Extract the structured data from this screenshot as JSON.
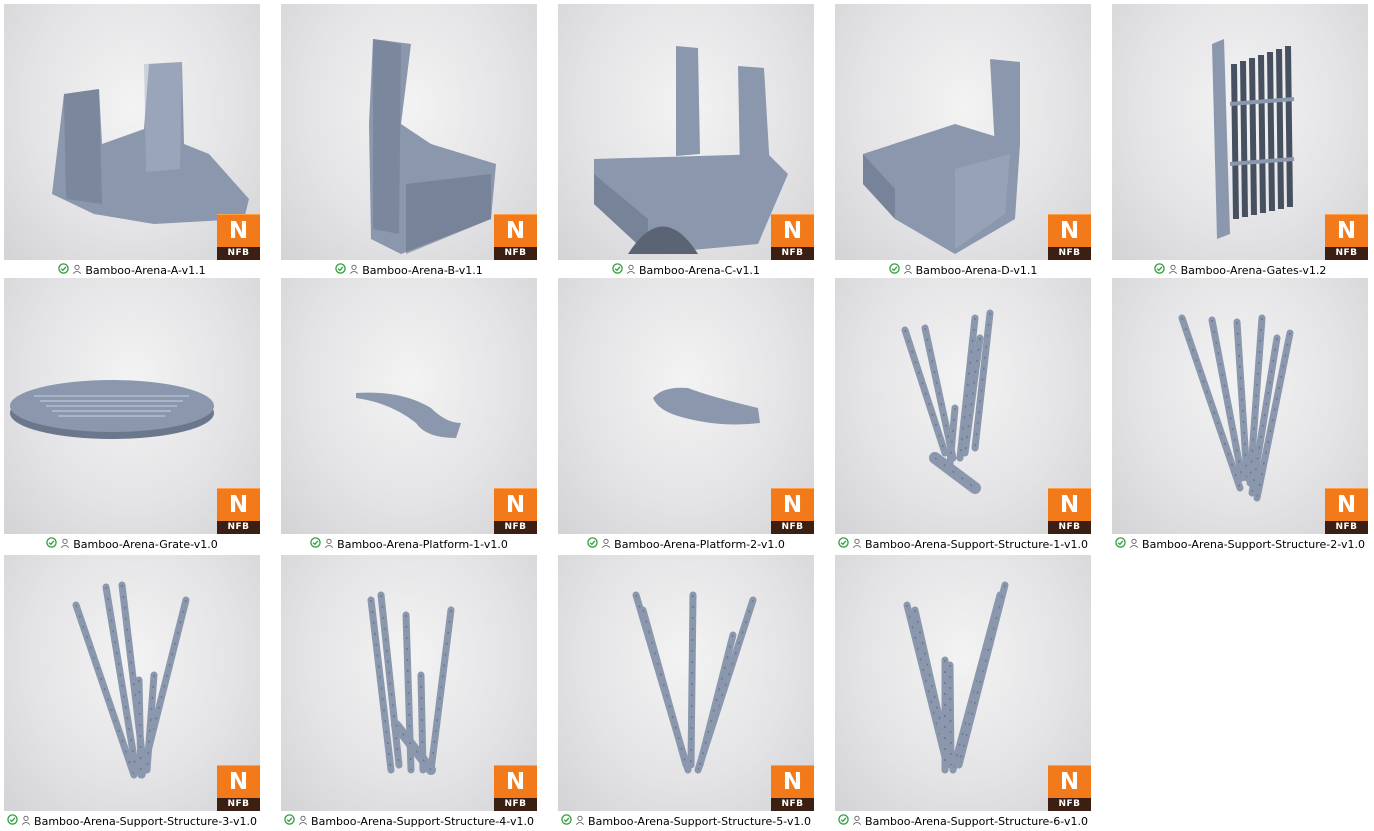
{
  "badge": {
    "letter": "N",
    "label": "NFB"
  },
  "colors": {
    "thumbnail_bg": "#e4e4e6",
    "model": "#8a97ad",
    "badge": "#f27a1a",
    "status_ok": "#2e9d3a"
  },
  "items": [
    {
      "name": "Bamboo-Arena-A-v1.1",
      "shape": "arena-a"
    },
    {
      "name": "Bamboo-Arena-B-v1.1",
      "shape": "arena-b"
    },
    {
      "name": "Bamboo-Arena-C-v1.1",
      "shape": "arena-c"
    },
    {
      "name": "Bamboo-Arena-D-v1.1",
      "shape": "arena-d"
    },
    {
      "name": "Bamboo-Arena-Gates-v1.2",
      "shape": "gates"
    },
    {
      "name": "Bamboo-Arena-Grate-v1.0",
      "shape": "grate"
    },
    {
      "name": "Bamboo-Arena-Platform-1-v1.0",
      "shape": "platform-1"
    },
    {
      "name": "Bamboo-Arena-Platform-2-v1.0",
      "shape": "platform-2"
    },
    {
      "name": "Bamboo-Arena-Support-Structure-1-v1.0",
      "shape": "support-1"
    },
    {
      "name": "Bamboo-Arena-Support-Structure-2-v1.0",
      "shape": "support-2"
    },
    {
      "name": "Bamboo-Arena-Support-Structure-3-v1.0",
      "shape": "support-3"
    },
    {
      "name": "Bamboo-Arena-Support-Structure-4-v1.0",
      "shape": "support-4"
    },
    {
      "name": "Bamboo-Arena-Support-Structure-5-v1.0",
      "shape": "support-5"
    },
    {
      "name": "Bamboo-Arena-Support-Structure-6-v1.0",
      "shape": "support-6"
    }
  ]
}
